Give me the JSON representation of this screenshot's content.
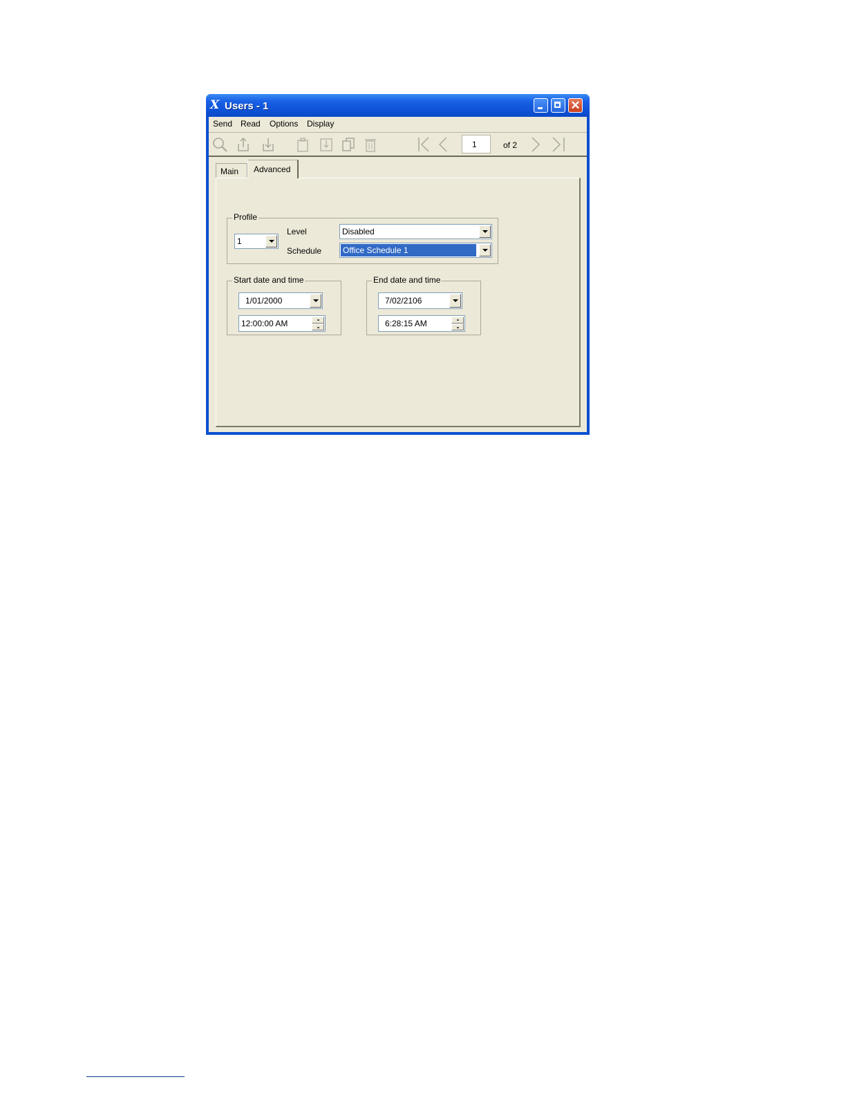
{
  "window": {
    "title": "Users - 1",
    "app_icon": "x-logo-icon"
  },
  "menu": [
    "Send",
    "Read",
    "Options",
    "Display"
  ],
  "toolbar": {
    "icons": [
      "search-icon",
      "upload-icon",
      "download-icon",
      "paste-icon",
      "insert-icon",
      "copy-icon",
      "trash-icon",
      "first-icon",
      "previous-icon",
      "next-icon",
      "last-icon"
    ],
    "page": "1",
    "of": "of 2"
  },
  "tabs": [
    "Main",
    "Advanced"
  ],
  "profile": {
    "label": "Profile",
    "number": "1",
    "level_label": "Level",
    "level_value": "Disabled",
    "schedule_label": "Schedule",
    "schedule_value": "Office Schedule 1"
  },
  "start": {
    "label": "Start date and time",
    "date": "1/01/2000",
    "time": "12:00:00 AM"
  },
  "end": {
    "label": "End date and time",
    "date": "7/02/2106",
    "time": "6:28:15 AM"
  },
  "colors": {
    "titlebar": "#0a4fd0",
    "face": "#ece9d8",
    "selection": "#316ac5"
  }
}
